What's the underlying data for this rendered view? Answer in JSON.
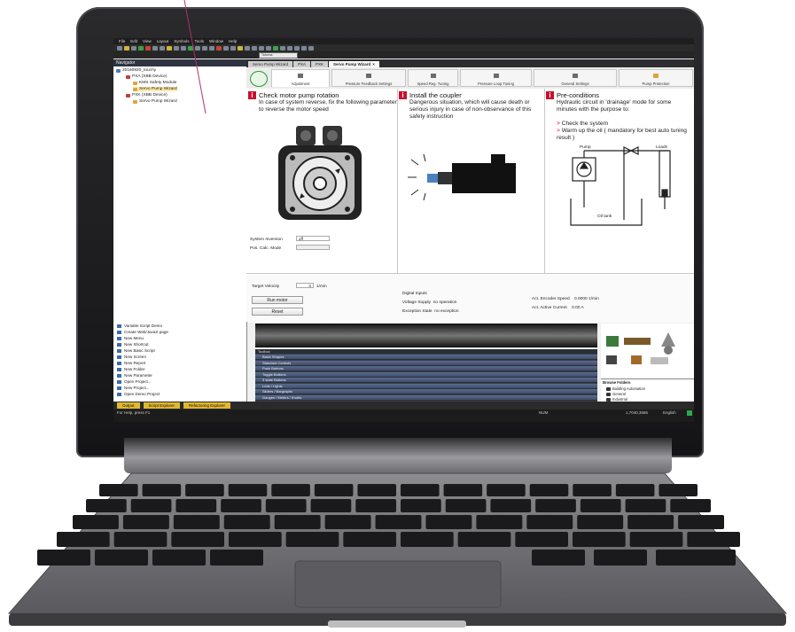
{
  "menu": [
    "File",
    "Edit",
    "View",
    "Layout",
    "Symbols",
    "Tools",
    "Window",
    "Help"
  ],
  "toolbar": {
    "combo_text": "Tahoma"
  },
  "navigator": {
    "title": "Navigator",
    "root": "20160920_touchy",
    "items": [
      {
        "label": "PXA (XBB Device)",
        "level": 1
      },
      {
        "label": "KMS Safety Module",
        "level": 2
      },
      {
        "label": "Servo Pump Wizard",
        "level": 2
      },
      {
        "label": "PXK (XBB Device)",
        "level": 1
      },
      {
        "label": "Servo Pump Wizard",
        "level": 2
      }
    ]
  },
  "editor_tabs": [
    {
      "label": "Servo Pump Wizard",
      "active": false
    },
    {
      "label": "PXA",
      "active": false
    },
    {
      "label": "PXK",
      "active": false
    },
    {
      "label": "Servo Pump Wizard",
      "active": true
    }
  ],
  "wizard_tabs": [
    "Adjustment",
    "Pressure Feedback Settings",
    "Speed Reg. Tuning",
    "Pressure Loop Tuning",
    "General Settings",
    "Pump Protection"
  ],
  "sections": [
    {
      "title": "Check motor pump rotation",
      "text": "In case of system reverse, fix the following parameter to reverse the motor speed"
    },
    {
      "title": "Install the coupler",
      "text": "Dangerous situation, which will cause death or serious injury in case of non-observance of this safety instruction"
    },
    {
      "title": "Pre-conditions",
      "text": "Hydraulic circuit in 'drainage' mode for some minutes with the purpose to:",
      "bullets": [
        "Check the system",
        "Warm up the oil ( mandatory for best auto tuning result )"
      ]
    }
  ],
  "settings": {
    "system_inversion_label": "System Inversion",
    "system_inversion_value": "off",
    "pos_calc_mode_label": "Pos. Calc. Mode",
    "pos_calc_mode_value": ""
  },
  "diagram_labels": {
    "pump": "Pump",
    "loads": "Loads",
    "oil_tank": "Oil tank"
  },
  "controls": {
    "target_velocity_label": "Target Velocity",
    "target_velocity_value": "0",
    "target_velocity_unit": "1/min",
    "run_motor": "Run motor",
    "reset": "Reset",
    "digital_inputs": "Digital Inputs",
    "voltage_supply_label": "Voltage Supply",
    "voltage_supply_value": "no operation",
    "exception_state_label": "Exception State",
    "exception_state_value": "no exception",
    "encoder_speed_label": "Act. Encoder Speed",
    "encoder_speed_value": "0.0000 1/min",
    "active_current_label": "Act. Active Current",
    "active_current_value": "0.00 A"
  },
  "actions": [
    "Variable Script Demo",
    "Create Web/JavaX page",
    "New Menu",
    "New Shortcut",
    "New Basic Script",
    "New Screen",
    "New Report",
    "New Folder",
    "New Parameter",
    "Open Project...",
    "New Project...",
    "Open Demo Project"
  ],
  "toolbox": {
    "title": "Toolbox",
    "items": [
      "Basic Shapes",
      "Standard Controls",
      "Push Buttons",
      "Toggle Buttons",
      "3 state Buttons",
      "Leds / Lights",
      "Sliders / Bargraphs",
      "Gauges / Meters / Knobs"
    ]
  },
  "browse": {
    "title": "Browse Folders",
    "items": [
      "Building Automation",
      "General",
      "Industrial"
    ]
  },
  "output_tabs": [
    "Output",
    "Script Explorer",
    "Refactoring Explorer"
  ],
  "status": {
    "help": "For Help, press F1",
    "num": "NUM",
    "resolution": "1,7040,3586",
    "language": "English"
  },
  "colors": {
    "accent_red": "#c8102e",
    "output_tab": "#e0b830",
    "toolbox_row": "#4f5f80"
  }
}
